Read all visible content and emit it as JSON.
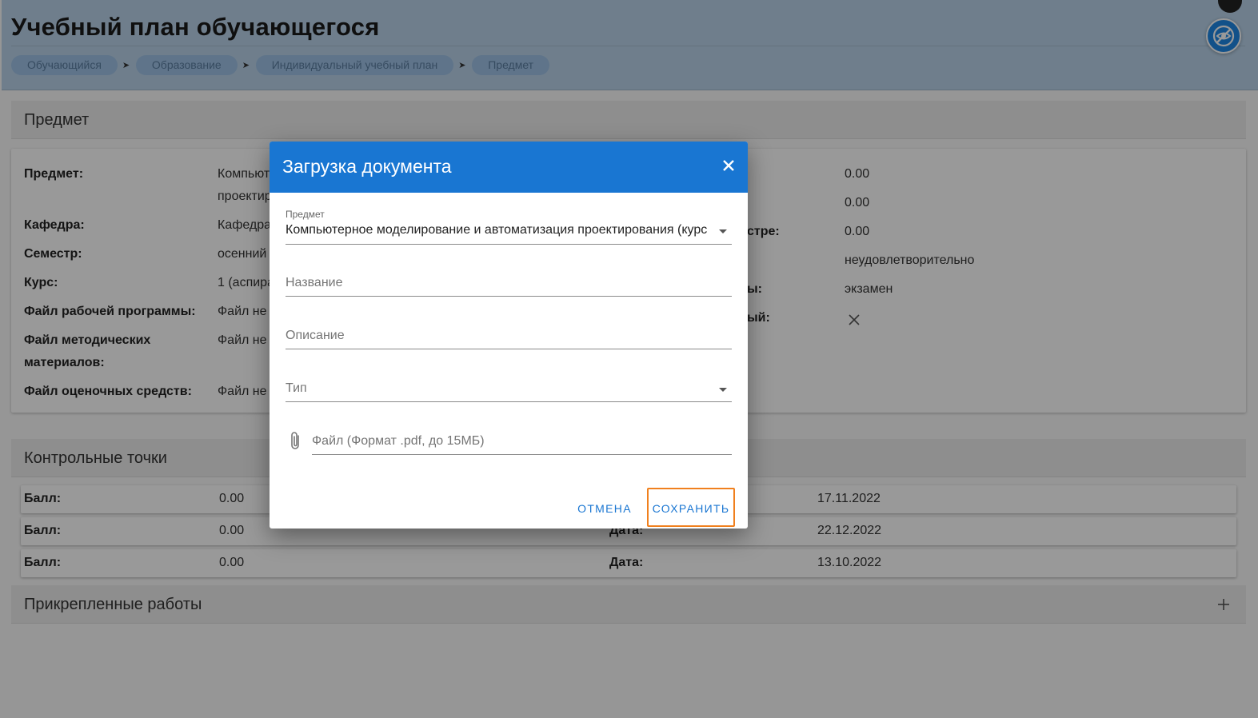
{
  "header": {
    "title": "Учебный план обучающегося",
    "breadcrumb": [
      "Обучающийся",
      "Образование",
      "Индивидуальный учебный план",
      "Предмет"
    ]
  },
  "subject_section": {
    "title": "Предмет",
    "left": [
      {
        "label": "Предмет:",
        "value_line1": "Компьют",
        "value_line2": "проектир"
      },
      {
        "label": "Кафедра:",
        "value": "Кафедра"
      },
      {
        "label": "Семестр:",
        "value": "осенний"
      },
      {
        "label": "Курс:",
        "value": "1 (аспира"
      },
      {
        "label": "Файл рабочей программы:",
        "value": "Файл не"
      },
      {
        "label_line1": "Файл методических",
        "label_line2": "материалов:",
        "value": "Файл не"
      },
      {
        "label": "Файл оценочных средств:",
        "value": "Файл не"
      }
    ],
    "right": [
      {
        "label": "",
        "value": "0.00"
      },
      {
        "label": "",
        "value": "0.00"
      },
      {
        "label": "стре:",
        "value": "0.00"
      },
      {
        "label": "",
        "value": "неудовлетворительно"
      },
      {
        "label": "ы:",
        "value": "экзамен"
      },
      {
        "label": "ый:",
        "value": "close-icon"
      }
    ]
  },
  "checkpoints": {
    "title": "Контрольные точки",
    "rows": [
      {
        "score_label": "Балл:",
        "score": "0.00",
        "date_label": "",
        "date": "17.11.2022"
      },
      {
        "score_label": "Балл:",
        "score": "0.00",
        "date_label": "Дата:",
        "date": "22.12.2022"
      },
      {
        "score_label": "Балл:",
        "score": "0.00",
        "date_label": "Дата:",
        "date": "13.10.2022"
      }
    ]
  },
  "attached": {
    "title": "Прикрепленные работы",
    "add_icon": "plus-icon"
  },
  "dialog": {
    "title": "Загрузка документа",
    "close_icon": "close-icon",
    "subject_label": "Предмет",
    "subject_value": "Компьютерное моделирование и автоматизация проектирования (курс",
    "name_placeholder": "Название",
    "description_placeholder": "Описание",
    "type_placeholder": "Тип",
    "file_placeholder": "Файл (Формат .pdf, до 15МБ)",
    "file_icon": "paperclip-icon",
    "cancel_label": "ОТМЕНА",
    "save_label": "СОХРАНИТЬ"
  },
  "colors": {
    "header_bg": "#b9d3ea",
    "primary": "#1976d2",
    "highlight": "#f0801e"
  }
}
